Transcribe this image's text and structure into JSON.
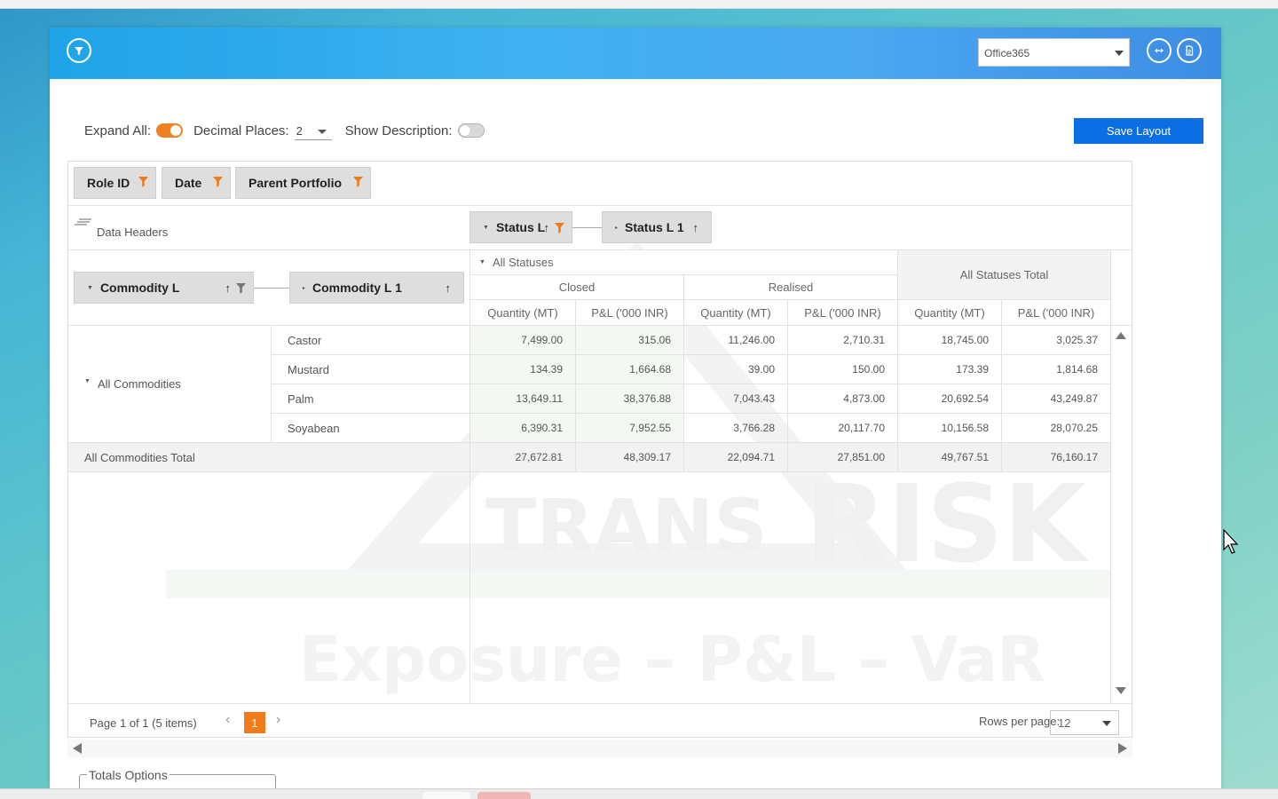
{
  "header": {
    "data_source_value": "Office365",
    "icons": [
      "funnel-icon",
      "swap-arrows-icon",
      "document-icon"
    ]
  },
  "toolbar": {
    "expand_all_label": "Expand All:",
    "expand_all_on": true,
    "decimal_places_label": "Decimal Places:",
    "decimal_places_value": "2",
    "show_description_label": "Show Description:",
    "show_description_on": false,
    "save_layout_label": "Save Layout"
  },
  "filter_fields": [
    "Role ID",
    "Date",
    "Parent Portfolio"
  ],
  "data_headers_label": "Data Headers",
  "column_fields": [
    "Status L",
    "Status L 1"
  ],
  "row_fields": [
    "Commodity L",
    "Commodity L 1"
  ],
  "columns": {
    "all_statuses": "All Statuses",
    "groups": [
      "Closed",
      "Realised"
    ],
    "total_label": "All Statuses Total",
    "measures": [
      "Quantity (MT)",
      "P&L ('000 INR)"
    ]
  },
  "rows": {
    "group_label": "All Commodities",
    "items": [
      {
        "name": "Castor",
        "values": [
          "7,499.00",
          "315.06",
          "11,246.00",
          "2,710.31",
          "18,745.00",
          "3,025.37"
        ]
      },
      {
        "name": "Mustard",
        "values": [
          "134.39",
          "1,664.68",
          "39.00",
          "150.00",
          "173.39",
          "1,814.68"
        ]
      },
      {
        "name": "Palm",
        "values": [
          "13,649.11",
          "38,376.88",
          "7,043.43",
          "4,873.00",
          "20,692.54",
          "43,249.87"
        ]
      },
      {
        "name": "Soyabean",
        "values": [
          "6,390.31",
          "7,952.55",
          "3,766.28",
          "20,117.70",
          "10,156.58",
          "28,070.25"
        ]
      }
    ],
    "total": {
      "name": "All Commodities Total",
      "values": [
        "27,672.81",
        "48,309.17",
        "22,094.71",
        "27,851.00",
        "49,767.51",
        "76,160.17"
      ]
    }
  },
  "pager": {
    "summary": "Page 1 of 1 (5 items)",
    "current_page": "1",
    "rows_per_page_label": "Rows per page:",
    "rows_per_page_value": "12"
  },
  "totals_options_label": "Totals Options",
  "watermark": {
    "line1_a": "TRANS",
    "line1_b": "RISK",
    "line2": "Exposure – P&L – VaR"
  }
}
